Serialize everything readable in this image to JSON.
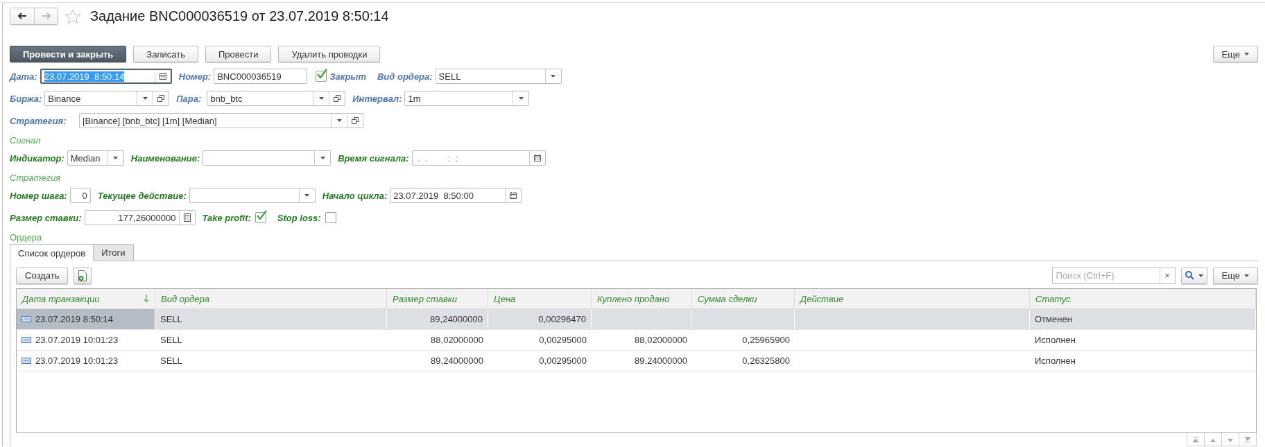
{
  "window": {
    "title": "Задание BNC000036519 от 23.07.2019 8:50:14",
    "favorite": false,
    "back_enabled": true,
    "forward_enabled": false
  },
  "toolbar": {
    "buttons": [
      {
        "label": "Провести и закрыть",
        "kind": "primary"
      },
      {
        "label": "Записать",
        "kind": "normal"
      },
      {
        "label": "Провести",
        "kind": "normal"
      },
      {
        "label": "Удалить проводки",
        "kind": "normal"
      }
    ],
    "more": "Еще"
  },
  "form": [
    {
      "kind": "main",
      "rows": [
        {
          "items": [
            {
              "kind": "date-field",
              "label": "Дата:",
              "value": "23.07.2019  8:50:14",
              "focused": true
            },
            {
              "kind": "text-field",
              "label": "Номер:",
              "value": "BNC000036519"
            },
            {
              "kind": "checkbox",
              "label": "Закрыт",
              "checked": true
            },
            {
              "kind": "select-field",
              "label": "Вид ордера:",
              "value": "SELL"
            }
          ]
        },
        {
          "items": [
            {
              "kind": "select-open-field",
              "label": "Биржа:",
              "value": "Binance"
            },
            {
              "kind": "select-open-field",
              "label": "Пара:",
              "value": "bnb_btc"
            },
            {
              "kind": "select-field",
              "label": "Интервал:",
              "value": "1m"
            }
          ]
        },
        {
          "items": [
            {
              "kind": "select-open-field",
              "label": "Стратегия:",
              "value": "[Binance] [bnb_btc] [1m] [Median]"
            }
          ]
        }
      ]
    },
    {
      "kind": "group",
      "heading": "Сигнал",
      "rows": [
        {
          "items": [
            {
              "kind": "select-field",
              "label": "Индикатор:",
              "value": "Median"
            },
            {
              "kind": "select-field",
              "label": "Наименование:"
            },
            {
              "kind": "date-field",
              "label": "Время сигнала:",
              "placeholder": " .  .        :  :"
            }
          ]
        }
      ]
    },
    {
      "kind": "group",
      "heading": "Стратегия",
      "rows": [
        {
          "items": [
            {
              "kind": "number-field",
              "label": "Номер шага:",
              "value": "0"
            },
            {
              "kind": "select-field",
              "label": "Текущее действие:"
            },
            {
              "kind": "date-field",
              "label": "Начало цикла:",
              "value": "23.07.2019  8:50:00"
            }
          ]
        },
        {
          "items": [
            {
              "kind": "calc-field",
              "label": "Размер ставки:",
              "value": "177,26000000"
            },
            {
              "kind": "checkbox",
              "label": "Take profit:",
              "checked": true
            },
            {
              "kind": "checkbox",
              "label": "Stop loss:",
              "checked": false
            }
          ]
        }
      ]
    }
  ],
  "orders": {
    "heading": "Ордера",
    "tabs": [
      {
        "label": "Список ордеров",
        "selected": true
      },
      {
        "label": "Итоги",
        "selected": false
      }
    ],
    "create": "Создать",
    "search": {
      "placeholder": "Поиск (Ctrl+F)",
      "clear": "×"
    },
    "more": "Еще",
    "table": {
      "columns": [
        {
          "label": "Дата транзакции",
          "kind": "text",
          "sorted": true
        },
        {
          "label": "Вид ордера",
          "kind": "text",
          "sorted": false
        },
        {
          "label": "Размер ставки",
          "kind": "number",
          "sorted": false
        },
        {
          "label": "Цена",
          "kind": "number",
          "sorted": false
        },
        {
          "label": "Куплено продано",
          "kind": "number",
          "sorted": false
        },
        {
          "label": "Сумма сделки",
          "kind": "number",
          "sorted": false
        },
        {
          "label": "Действие",
          "kind": "text",
          "sorted": false
        },
        {
          "label": "Статус",
          "kind": "text",
          "sorted": false
        }
      ],
      "rows": [
        {
          "selected": true,
          "cells": [
            "23.07.2019 8:50:14",
            "SELL",
            "89,24000000",
            "0,00296470",
            "",
            "",
            "",
            "Отменен"
          ]
        },
        {
          "selected": false,
          "cells": [
            "23.07.2019 10:01:23",
            "SELL",
            "88,02000000",
            "0,00295000",
            "88,02000000",
            "0,25965900",
            "",
            "Исполнен"
          ]
        },
        {
          "selected": false,
          "cells": [
            "23.07.2019 10:01:23",
            "SELL",
            "89,24000000",
            "0,00295000",
            "89,24000000",
            "0,26325800",
            "",
            "Исполнен"
          ]
        }
      ]
    }
  }
}
